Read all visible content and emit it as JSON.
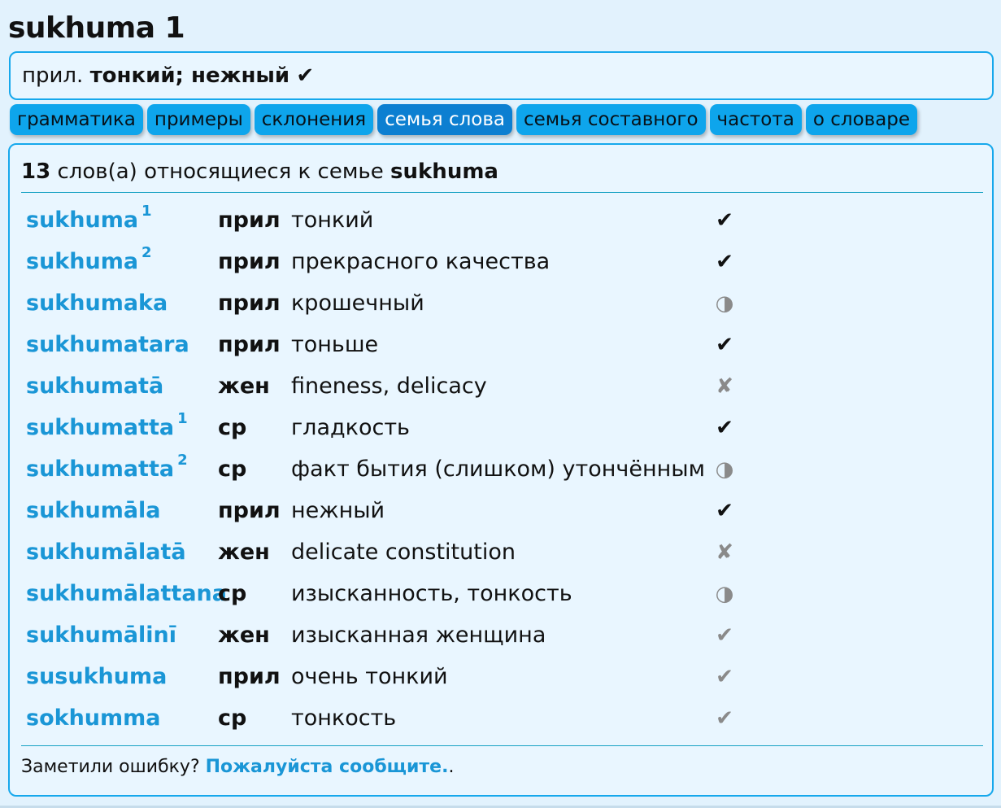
{
  "headword": "sukhuma 1",
  "summary": {
    "pos": "прил.",
    "meaning": "тонкий; нежный",
    "mark": "✔"
  },
  "tabs": [
    "грамматика",
    "примеры",
    "склонения",
    "семья слова",
    "семья составного",
    "частота",
    "о словаре"
  ],
  "active_tab": "семья слова",
  "family": {
    "count": "13",
    "text": "слов(а) относящиеся к семье",
    "root": "sukhuma"
  },
  "rows": [
    {
      "word": "sukhuma",
      "sup": "1",
      "pos": "прил",
      "meaning": "тонкий",
      "status": "✔",
      "status_kind": "ok"
    },
    {
      "word": "sukhuma",
      "sup": "2",
      "pos": "прил",
      "meaning": "прекрасного качества",
      "status": "✔",
      "status_kind": "ok"
    },
    {
      "word": "sukhumaka",
      "sup": "",
      "pos": "прил",
      "meaning": "крошечный",
      "status": "◑",
      "status_kind": "half"
    },
    {
      "word": "sukhumatara",
      "sup": "",
      "pos": "прил",
      "meaning": "тоньше",
      "status": "✔",
      "status_kind": "ok"
    },
    {
      "word": "sukhumatā",
      "sup": "",
      "pos": "жен",
      "meaning": "fineness, delicacy",
      "status": "✘",
      "status_kind": "x"
    },
    {
      "word": "sukhumatta",
      "sup": "1",
      "pos": "ср",
      "meaning": "гладкость",
      "status": "✔",
      "status_kind": "ok"
    },
    {
      "word": "sukhumatta",
      "sup": "2",
      "pos": "ср",
      "meaning": "факт бытия (слишком) утончённым",
      "status": "◑",
      "status_kind": "half"
    },
    {
      "word": "sukhumāla",
      "sup": "",
      "pos": "прил",
      "meaning": "нежный",
      "status": "✔",
      "status_kind": "ok"
    },
    {
      "word": "sukhumālatā",
      "sup": "",
      "pos": "жен",
      "meaning": "delicate constitution",
      "status": "✘",
      "status_kind": "x"
    },
    {
      "word": "sukhumālattana",
      "sup": "",
      "pos": "ср",
      "meaning": "изысканность, тонкость",
      "status": "◑",
      "status_kind": "half"
    },
    {
      "word": "sukhumālinī",
      "sup": "",
      "pos": "жен",
      "meaning": "изысканная женщина",
      "status": "✔",
      "status_kind": "grey"
    },
    {
      "word": "susukhuma",
      "sup": "",
      "pos": "прил",
      "meaning": "очень тонкий",
      "status": "✔",
      "status_kind": "grey"
    },
    {
      "word": "sokhumma",
      "sup": "",
      "pos": "ср",
      "meaning": "тонкость",
      "status": "✔",
      "status_kind": "grey"
    }
  ],
  "footer": {
    "text": "Заметили ошибку?",
    "link": "Пожалуйста сообщите.",
    "tail": "."
  },
  "colors": {
    "accent": "#16a8ec",
    "tab": "#0ea5ec",
    "tab_active": "#0c7fd1",
    "link": "#1a96d6",
    "background": "#e2f2fd"
  }
}
